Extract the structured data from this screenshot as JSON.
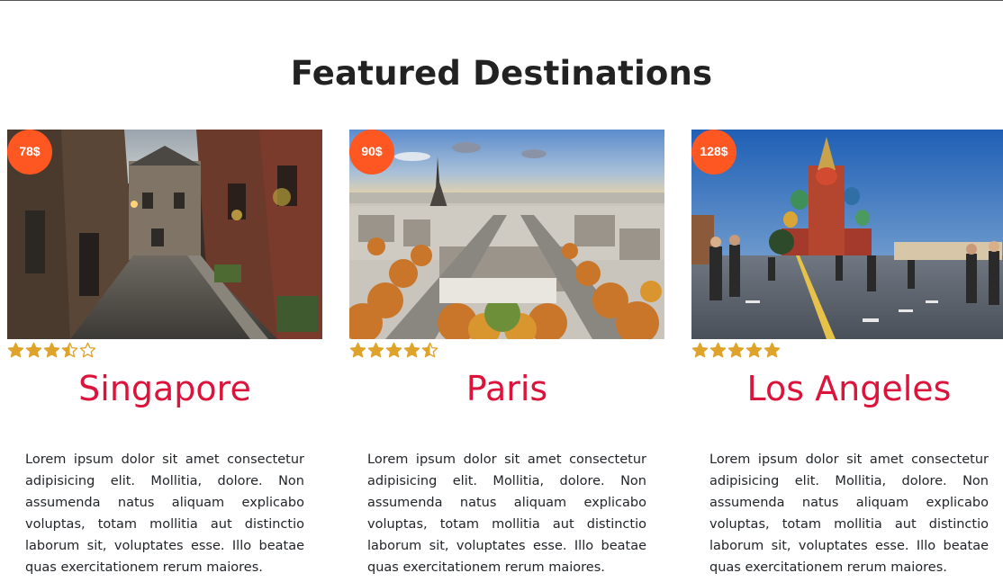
{
  "section": {
    "title": "Featured Destinations"
  },
  "colors": {
    "accent": "#dc143c",
    "badge": "#ff5722",
    "star": "#e0a32a"
  },
  "cards": [
    {
      "price": "78$",
      "rating": 3.5,
      "title": "Singapore",
      "description": "Lorem ipsum dolor sit amet consectetur adipisicing elit. Mollitia, dolore. Non assumenda natus aliquam explicabo voluptas, totam mollitia aut distinctio laborum sit, voluptates esse. Illo beatae quas exercitationem rerum maiores.",
      "image": "cobblestone-street-photo"
    },
    {
      "price": "90$",
      "rating": 4.5,
      "title": "Paris",
      "description": "Lorem ipsum dolor sit amet consectetur adipisicing elit. Mollitia, dolore. Non assumenda natus aliquam explicabo voluptas, totam mollitia aut distinctio laborum sit, voluptates esse. Illo beatae quas exercitationem rerum maiores.",
      "image": "paris-eiffel-tower-photo"
    },
    {
      "price": "128$",
      "rating": 5,
      "title": "Los Angeles",
      "description": "Lorem ipsum dolor sit amet consectetur adipisicing elit. Mollitia, dolore. Non assumenda natus aliquam explicabo voluptas, totam mollitia aut distinctio laborum sit, voluptates esse. Illo beatae quas exercitationem rerum maiores.",
      "image": "red-square-cathedral-photo"
    }
  ]
}
